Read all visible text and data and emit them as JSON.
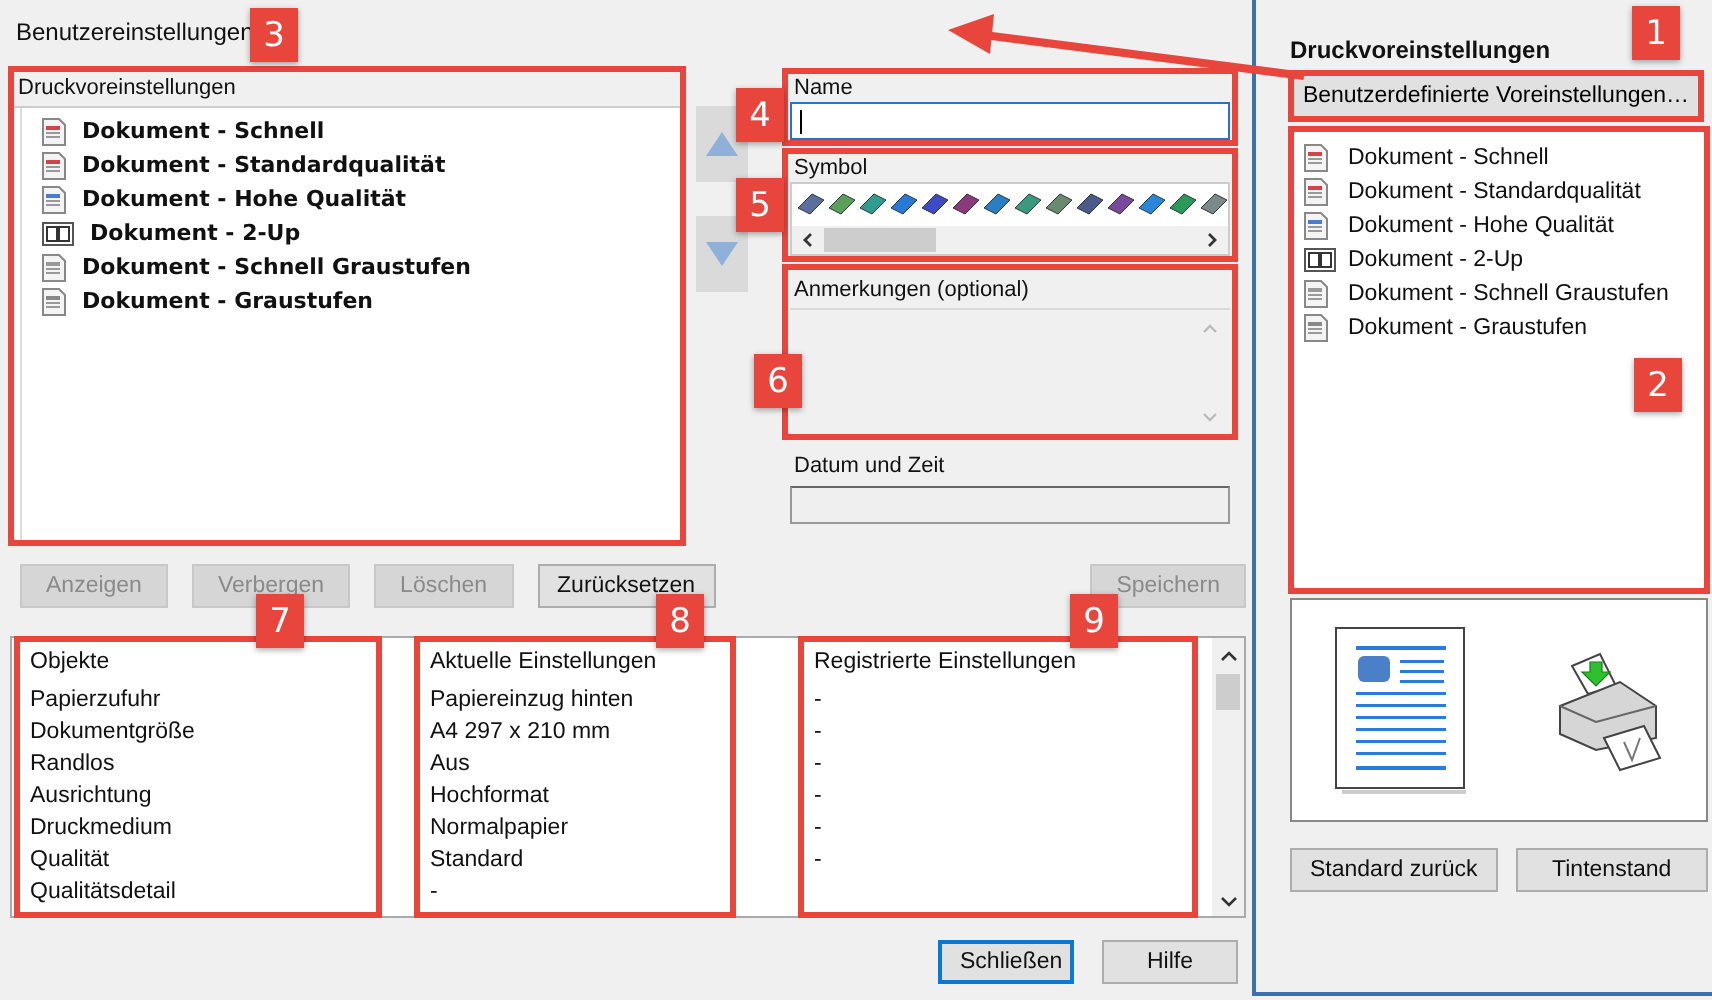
{
  "dialog": {
    "title": "Benutzereinstellungen",
    "callout": "3",
    "presets": {
      "label": "Druckvoreinstellungen",
      "items": [
        {
          "label": "Dokument - Schnell",
          "kind": "color"
        },
        {
          "label": "Dokument - Standardqualität",
          "kind": "color"
        },
        {
          "label": "Dokument - Hohe Qualität",
          "kind": "photo"
        },
        {
          "label": "Dokument - 2-Up",
          "kind": "two-up"
        },
        {
          "label": "Dokument - Schnell Graustufen",
          "kind": "gray"
        },
        {
          "label": "Dokument - Graustufen",
          "kind": "gray-photo"
        }
      ]
    },
    "name_field": {
      "label": "Name",
      "callout": "4"
    },
    "symbol": {
      "label": "Symbol",
      "callout": "5"
    },
    "notes": {
      "label": "Anmerkungen (optional)",
      "callout": "6"
    },
    "date": {
      "label": "Datum und Zeit"
    },
    "buttons": [
      {
        "label": "Anzeigen",
        "disabled": true
      },
      {
        "label": "Verbergen",
        "disabled": true
      },
      {
        "label": "Löschen",
        "disabled": true
      },
      {
        "label": "Zurücksetzen",
        "disabled": false
      }
    ],
    "save_button": {
      "label": "Speichern",
      "disabled": true
    },
    "settings_table": {
      "columns": [
        {
          "label": "Objekte",
          "callout": "7"
        },
        {
          "label": "Aktuelle Einstellungen",
          "callout": "8"
        },
        {
          "label": "Registrierte Einstellungen",
          "callout": "9"
        }
      ],
      "rows": [
        [
          "Papierzufuhr",
          "Papiereinzug hinten",
          "-"
        ],
        [
          "Dokumentgröße",
          "A4 297 x 210 mm",
          "-"
        ],
        [
          "Randlos",
          "Aus",
          "-"
        ],
        [
          "Ausrichtung",
          "Hochformat",
          "-"
        ],
        [
          "Druckmedium",
          "Normalpapier",
          "-"
        ],
        [
          "Qualität",
          "Standard",
          "-"
        ],
        [
          "Qualitätsdetail",
          "-"
        ]
      ]
    },
    "footer_buttons": [
      {
        "label": "Schließen",
        "default": true
      },
      {
        "label": "Hilfe",
        "default": false
      }
    ]
  },
  "side_panel": {
    "title": "Druckvoreinstellungen",
    "custom_button": {
      "label": "Benutzerdefinierte Voreinstellungen…",
      "callout": "1"
    },
    "list_callout": "2",
    "items": [
      {
        "label": "Dokument - Schnell",
        "kind": "color"
      },
      {
        "label": "Dokument - Standardqualität",
        "kind": "color"
      },
      {
        "label": "Dokument - Hohe Qualität",
        "kind": "photo"
      },
      {
        "label": "Dokument - 2-Up",
        "kind": "two-up"
      },
      {
        "label": "Dokument - Schnell Graustufen",
        "kind": "gray"
      },
      {
        "label": "Dokument - Graustufen",
        "kind": "gray-photo"
      }
    ],
    "buttons": [
      "Standard zurück",
      "Tintenstand"
    ]
  }
}
